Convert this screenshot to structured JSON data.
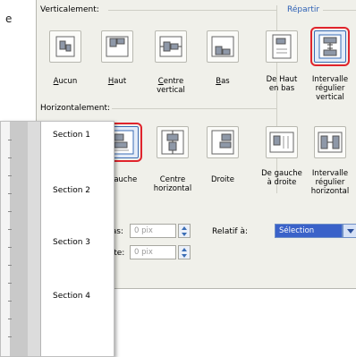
{
  "crop_text": "e",
  "vertical": {
    "label": "Verticalement:",
    "buttons": [
      {
        "caption": "Aucun",
        "underline": "A"
      },
      {
        "caption": "Haut",
        "underline": "H"
      },
      {
        "caption": "Centre\nvertical",
        "underline": "C"
      },
      {
        "caption": "Bas",
        "underline": "B"
      }
    ]
  },
  "distribute": {
    "label": "Répartir",
    "buttons": [
      {
        "caption": "De Haut\nen bas"
      },
      {
        "caption": "Intervalle\nrégulier\nvertical"
      }
    ]
  },
  "horizontal": {
    "label": "Horizontalement:",
    "buttons": [
      {
        "caption": "Gauche"
      },
      {
        "caption": "Centre\nhorizontal"
      },
      {
        "caption": "Droite"
      }
    ]
  },
  "distribute_h": {
    "buttons": [
      {
        "caption": "De gauche\nà droite"
      },
      {
        "caption": "Intervalle\nrégulier\nhorizontal"
      }
    ]
  },
  "fields": {
    "top_label": "bas:",
    "top_value": "0 pix",
    "left_label": "gite:",
    "left_value": "0 pix",
    "relative_label": "Relatif à:",
    "relative_value": "Sélection"
  },
  "panel": {
    "sections": [
      "Section 1",
      "Section 2",
      "Section 3",
      "Section 4"
    ]
  },
  "colors": {
    "highlight_ring": "#e0242c",
    "accent": "#3a62c9"
  }
}
